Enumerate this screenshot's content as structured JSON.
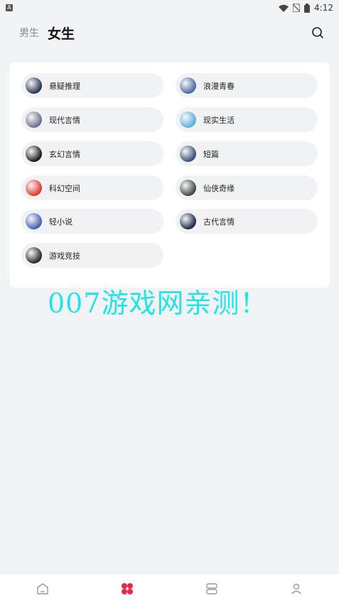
{
  "status_bar": {
    "notification_badge": "A",
    "time": "4:12"
  },
  "header": {
    "tabs": [
      {
        "label": "男生",
        "active": false
      },
      {
        "label": "女生",
        "active": true
      }
    ]
  },
  "categories": [
    {
      "label": "悬疑推理",
      "cover_color": "#2a3550"
    },
    {
      "label": "浪漫青春",
      "cover_color": "#4a6aa8"
    },
    {
      "label": "现代言情",
      "cover_color": "#6d6f92"
    },
    {
      "label": "现实生活",
      "cover_color": "#5ab0e0"
    },
    {
      "label": "玄幻言情",
      "cover_color": "#1a1a1a"
    },
    {
      "label": "短篇",
      "cover_color": "#3b4f7a"
    },
    {
      "label": "科幻空间",
      "cover_color": "#e03a2c"
    },
    {
      "label": "仙侠奇缘",
      "cover_color": "#3d4a3a"
    },
    {
      "label": "轻小说",
      "cover_color": "#4660b0"
    },
    {
      "label": "古代言情",
      "cover_color": "#1d2a44"
    },
    {
      "label": "游戏竞技",
      "cover_color": "#2e2622"
    }
  ],
  "watermark": "007游戏网亲测！",
  "bottom_nav": [
    {
      "icon": "home-icon",
      "active": false
    },
    {
      "icon": "category-icon",
      "active": true
    },
    {
      "icon": "bookshelf-icon",
      "active": false
    },
    {
      "icon": "profile-icon",
      "active": false
    }
  ],
  "colors": {
    "accent": "#e8294b",
    "background": "#f2f3f5",
    "watermark": "#22e4e8"
  }
}
